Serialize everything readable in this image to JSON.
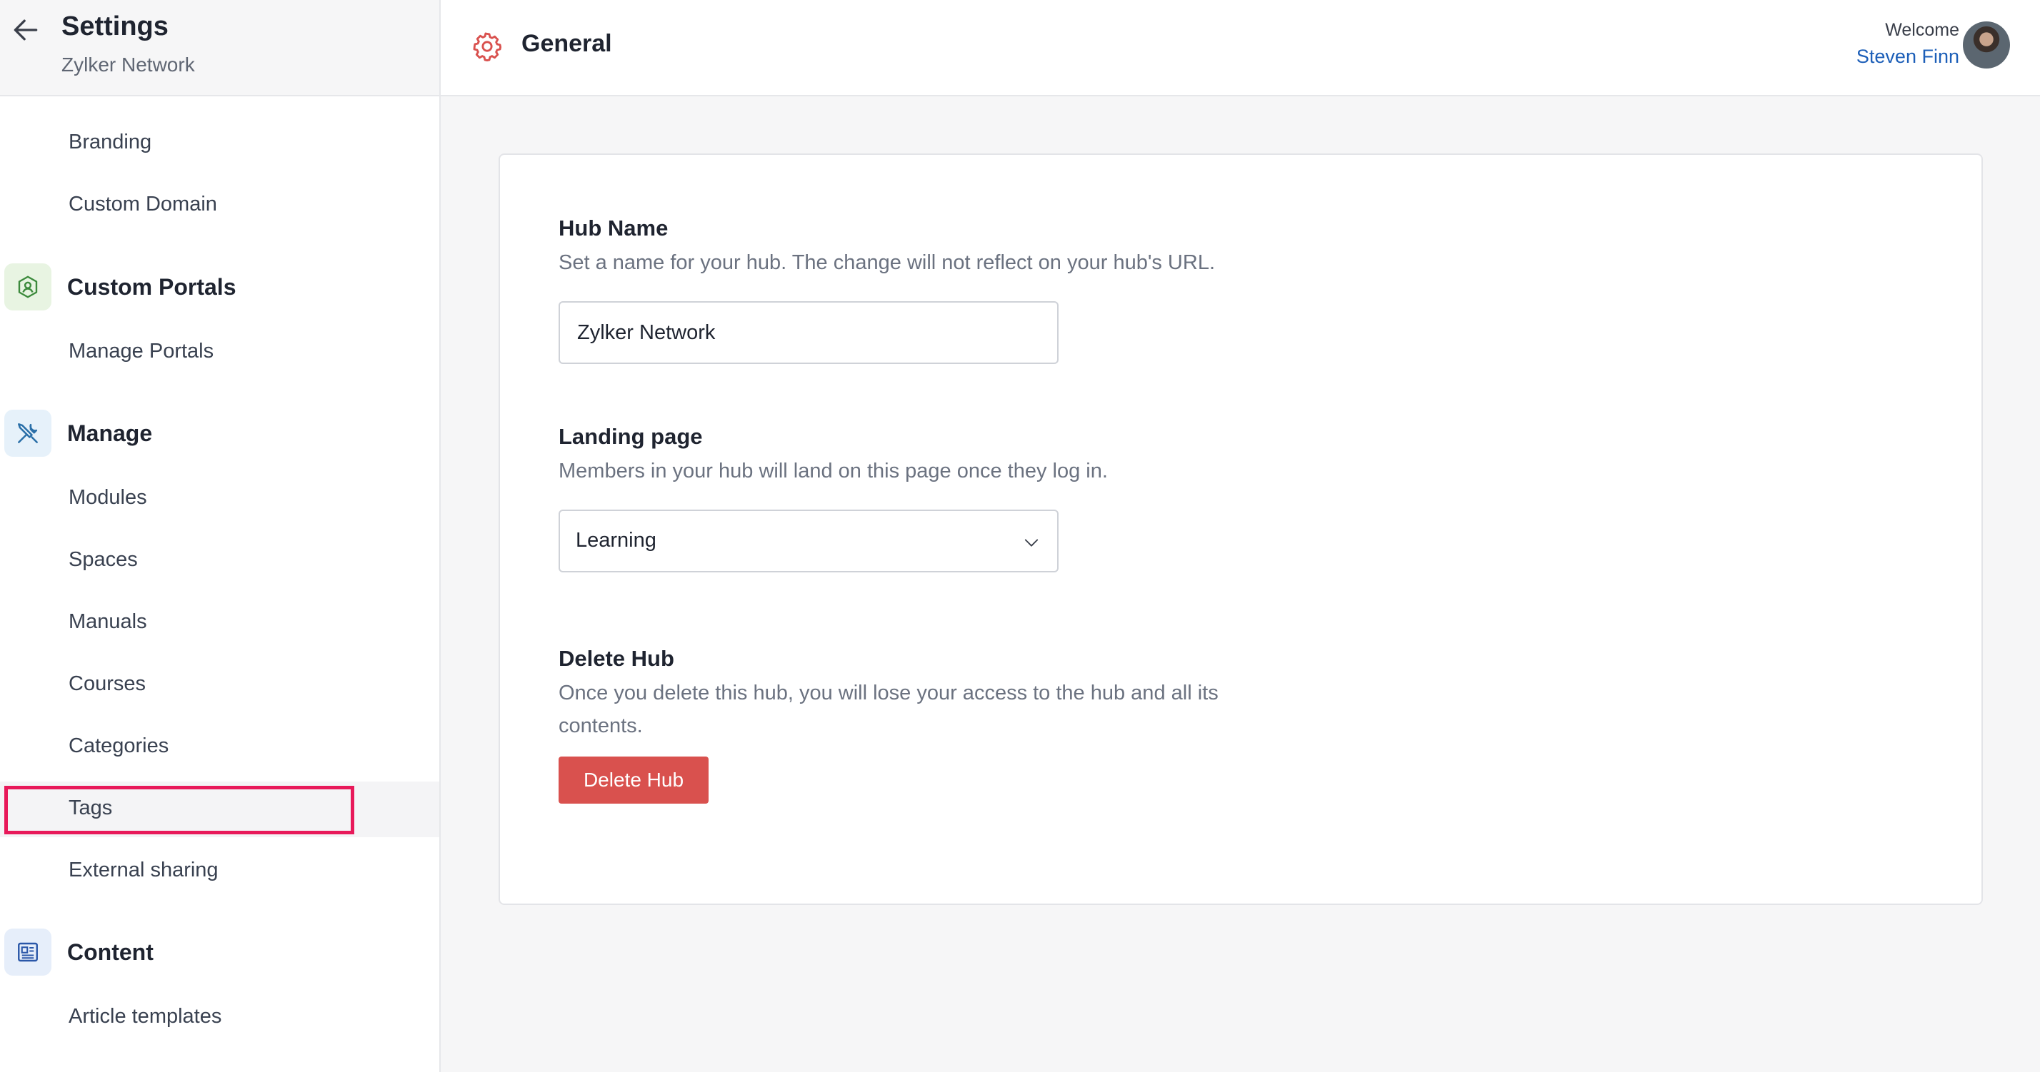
{
  "sidebar": {
    "title": "Settings",
    "subtitle": "Zylker Network",
    "items_top": [
      {
        "label": "Branding"
      },
      {
        "label": "Custom Domain"
      }
    ],
    "sections": {
      "custom_portals": {
        "label": "Custom Portals",
        "icon": "user-shield-icon",
        "items": [
          {
            "label": "Manage Portals"
          }
        ]
      },
      "manage": {
        "label": "Manage",
        "icon": "tools-icon",
        "items": [
          {
            "label": "Modules"
          },
          {
            "label": "Spaces"
          },
          {
            "label": "Manuals"
          },
          {
            "label": "Courses"
          },
          {
            "label": "Categories"
          },
          {
            "label": "Tags",
            "highlighted": true
          },
          {
            "label": "External sharing"
          }
        ]
      },
      "content": {
        "label": "Content",
        "icon": "document-icon",
        "items": [
          {
            "label": "Article templates"
          }
        ]
      }
    }
  },
  "header": {
    "title": "General",
    "icon": "gear-icon",
    "welcome": "Welcome",
    "user_name": "Steven Finn"
  },
  "form": {
    "hub_name": {
      "title": "Hub Name",
      "description": "Set a name for your hub. The change will not reflect on your hub's URL.",
      "value": "Zylker Network"
    },
    "landing_page": {
      "title": "Landing page",
      "description": "Members in your hub will land on this page once they log in.",
      "selected": "Learning"
    },
    "delete_hub": {
      "title": "Delete Hub",
      "description": "Once you delete this hub, you will lose your access to the hub and all its contents.",
      "button_label": "Delete Hub"
    }
  },
  "colors": {
    "accent_red": "#d9514e",
    "highlight": "#e8195a",
    "link_blue": "#1d5fb8"
  }
}
